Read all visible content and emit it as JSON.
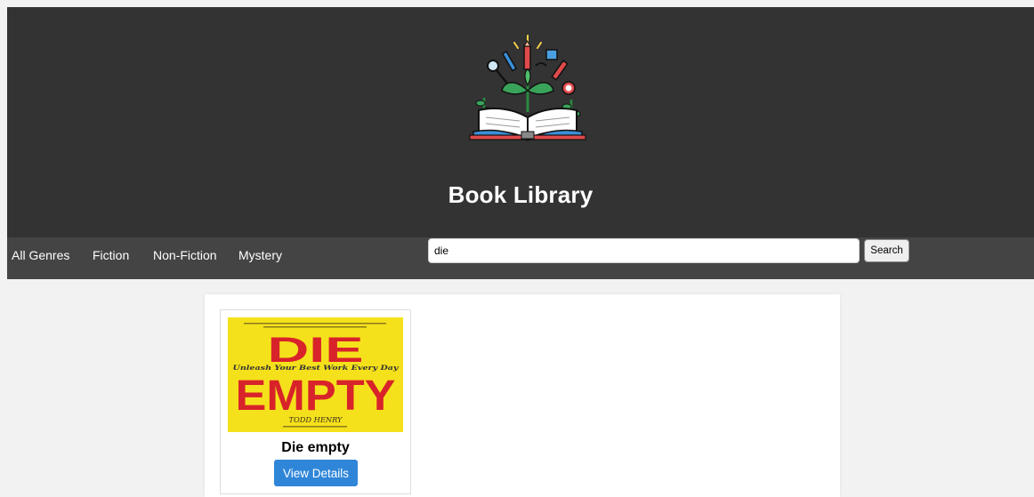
{
  "header": {
    "title": "Book Library",
    "logo_icon": "book-plant-logo-icon"
  },
  "nav": {
    "links": [
      "All Genres",
      "Fiction",
      "Non-Fiction",
      "Mystery"
    ]
  },
  "search": {
    "value": "die",
    "button_label": "Search"
  },
  "books": [
    {
      "title": "Die empty",
      "button_label": "View Details",
      "cover": {
        "tagline": "Unleash Your Best Work Every Day",
        "word1": "DIE",
        "word2": "EMPTY",
        "author": "TODD HENRY",
        "background": "#f5e11b",
        "title_color": "#d8232a"
      }
    }
  ],
  "colors": {
    "header_bg": "#333333",
    "nav_bg": "#444444",
    "page_bg": "#f2f2f2",
    "button_accent": "#2f86d8"
  }
}
